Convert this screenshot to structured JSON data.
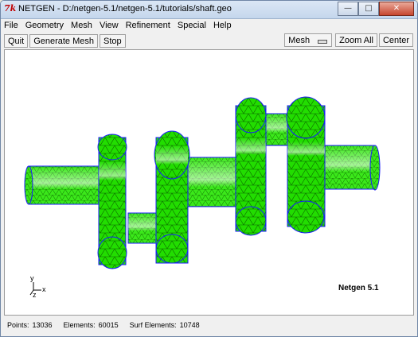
{
  "window": {
    "icon": "tk-feather-icon",
    "title": "NETGEN - D:/netgen-5.1/netgen-5.1/tutorials/shaft.geo",
    "controls": [
      "minimize",
      "maximize",
      "close"
    ]
  },
  "menu": [
    "File",
    "Geometry",
    "Mesh",
    "View",
    "Refinement",
    "Special",
    "Help"
  ],
  "toolbar": {
    "quit": "Quit",
    "generate": "Generate Mesh",
    "stop": "Stop",
    "view_select": "Mesh",
    "zoom_all": "Zoom All",
    "center": "Center"
  },
  "viewport": {
    "version": "Netgen 5.1",
    "axes": {
      "y": "y",
      "x": "x",
      "z": "z"
    },
    "mesh_color": "#22dd00",
    "edge_color": "#1a1aff"
  },
  "status": {
    "points_label": "Points:",
    "points": "13036",
    "elements_label": "Elements:",
    "elements": "60015",
    "surf_label": "Surf Elements:",
    "surf": "10748"
  }
}
